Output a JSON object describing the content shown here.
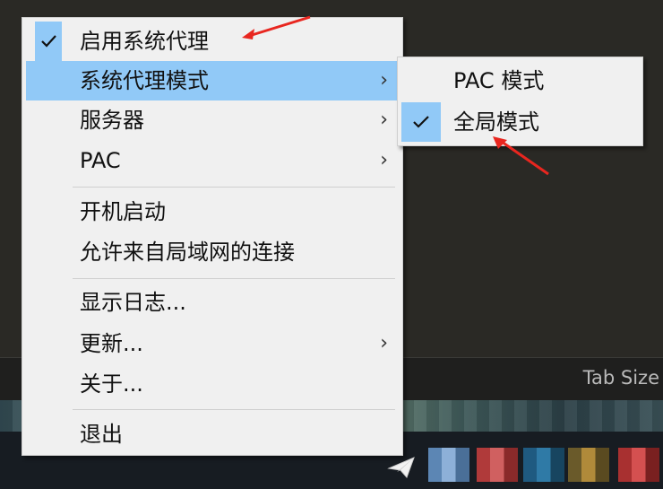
{
  "background": {
    "status_bar_text": "Tab Size"
  },
  "context_menu": {
    "items": [
      {
        "label": "启用系统代理",
        "checked": true,
        "has_submenu": false,
        "highlighted": false
      },
      {
        "label": "系统代理模式",
        "checked": false,
        "has_submenu": true,
        "highlighted": true
      },
      {
        "label": "服务器",
        "checked": false,
        "has_submenu": true,
        "highlighted": false
      },
      {
        "label": "PAC",
        "checked": false,
        "has_submenu": true,
        "highlighted": false
      },
      {
        "label": "开机启动",
        "checked": false,
        "has_submenu": false,
        "highlighted": false
      },
      {
        "label": "允许来自局域网的连接",
        "checked": false,
        "has_submenu": false,
        "highlighted": false
      },
      {
        "label": "显示日志...",
        "checked": false,
        "has_submenu": false,
        "highlighted": false
      },
      {
        "label": "更新...",
        "checked": false,
        "has_submenu": true,
        "highlighted": false
      },
      {
        "label": "关于...",
        "checked": false,
        "has_submenu": false,
        "highlighted": false
      },
      {
        "label": "退出",
        "checked": false,
        "has_submenu": false,
        "highlighted": false
      }
    ],
    "submenu_arrow": "›"
  },
  "proxy_mode_submenu": {
    "items": [
      {
        "label": "PAC 模式",
        "checked": false
      },
      {
        "label": "全局模式",
        "checked": true
      }
    ]
  },
  "icons": {
    "check": "check-icon",
    "submenu_arrow": "chevron-right-icon",
    "tray_app": "paper-plane-icon"
  },
  "colors": {
    "menu_background": "#f0f0f0",
    "highlight": "#91c9f7",
    "annotation_arrow": "#e8261f"
  }
}
